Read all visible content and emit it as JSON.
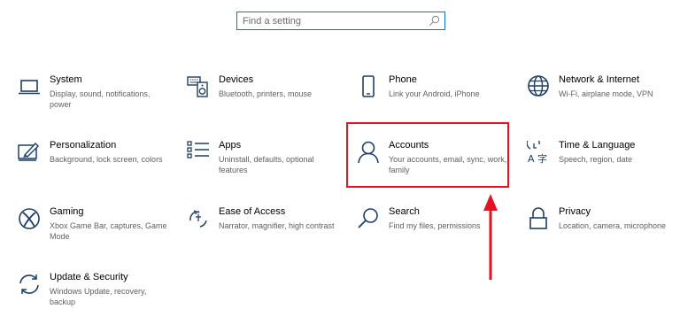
{
  "search": {
    "placeholder": "Find a setting",
    "icon": "search-icon"
  },
  "tiles": [
    {
      "title": "System",
      "desc": "Display, sound, notifications, power",
      "icon": "laptop-icon"
    },
    {
      "title": "Devices",
      "desc": "Bluetooth, printers, mouse",
      "icon": "keyboard-speaker-icon"
    },
    {
      "title": "Phone",
      "desc": "Link your Android, iPhone",
      "icon": "phone-icon"
    },
    {
      "title": "Network & Internet",
      "desc": "Wi-Fi, airplane mode, VPN",
      "icon": "globe-icon"
    },
    {
      "title": "Personalization",
      "desc": "Background, lock screen, colors",
      "icon": "paint-icon"
    },
    {
      "title": "Apps",
      "desc": "Uninstall, defaults, optional features",
      "icon": "apps-list-icon"
    },
    {
      "title": "Accounts",
      "desc": "Your accounts, email, sync, work, family",
      "icon": "person-icon"
    },
    {
      "title": "Time & Language",
      "desc": "Speech, region, date",
      "icon": "time-language-icon"
    },
    {
      "title": "Gaming",
      "desc": "Xbox Game Bar, captures, Game Mode",
      "icon": "xbox-icon"
    },
    {
      "title": "Ease of Access",
      "desc": "Narrator, magnifier, high contrast",
      "icon": "ease-of-access-icon"
    },
    {
      "title": "Search",
      "desc": "Find my files, permissions",
      "icon": "search-icon"
    },
    {
      "title": "Privacy",
      "desc": "Location, camera, microphone",
      "icon": "lock-icon"
    },
    {
      "title": "Update & Security",
      "desc": "Windows Update, recovery, backup",
      "icon": "sync-icon"
    }
  ],
  "colors": {
    "accent": "#0078d7",
    "highlight": "#e81123",
    "icon": "#1f3e63"
  }
}
